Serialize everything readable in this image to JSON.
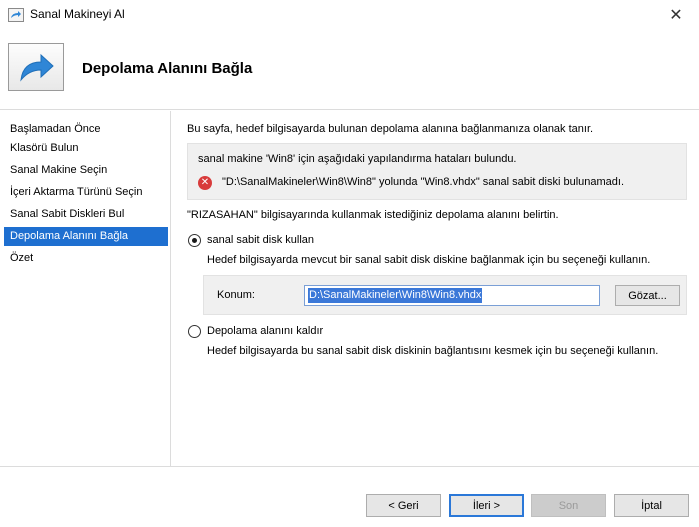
{
  "window": {
    "title": "Sanal Makineyi Al",
    "close_glyph": "✕",
    "app_icon": "import-arrow-icon"
  },
  "header": {
    "heading": "Depolama Alanını Bağla",
    "icon": "import-arrow-icon"
  },
  "sidebar": {
    "items": [
      {
        "label": "Başlamadan Önce",
        "active": false
      },
      {
        "label": "Klasörü Bulun",
        "active": false
      },
      {
        "label": "Sanal Makine Seçin",
        "active": false
      },
      {
        "label": "İçeri Aktarma Türünü Seçin",
        "active": false
      },
      {
        "label": "Sanal Sabit Diskleri Bul",
        "active": false
      },
      {
        "label": "Depolama Alanını Bağla",
        "active": true
      },
      {
        "label": "Özet",
        "active": false
      }
    ]
  },
  "main": {
    "intro": "Bu sayfa, hedef bilgisayarda bulunan depolama alanına bağlanmanıza olanak tanır.",
    "error_box": {
      "title": "sanal makine 'Win8' için aşağıdaki yapılandırma hataları bulundu.",
      "icon": "error-icon",
      "message": "\"D:\\SanalMakineler\\Win8\\Win8\" yolunda \"Win8.vhdx\" sanal sabit diski bulunamadı."
    },
    "specify_text": "\"RIZASAHAN\" bilgisayarında kullanmak istediğiniz depolama alanını belirtin.",
    "option_use": {
      "label": "sanal sabit disk kullan",
      "description": "Hedef bilgisayarda mevcut bir sanal sabit disk diskine bağlanmak için bu seçeneği kullanın.",
      "selected": true
    },
    "location": {
      "label": "Konum:",
      "value": "D:\\SanalMakineler\\Win8\\Win8.vhdx",
      "browse_label": "Gözat..."
    },
    "option_remove": {
      "label": "Depolama alanını kaldır",
      "description": "Hedef bilgisayarda bu sanal sabit disk diskinin bağlantısını kesmek için bu seçeneği kullanın.",
      "selected": false
    }
  },
  "footer": {
    "back_label": "< Geri",
    "next_label": "İleri >",
    "finish_label": "Son",
    "cancel_label": "İptal"
  },
  "colors": {
    "accent": "#1e6fd0",
    "error": "#d83b3b",
    "selection": "#3b78d8"
  }
}
